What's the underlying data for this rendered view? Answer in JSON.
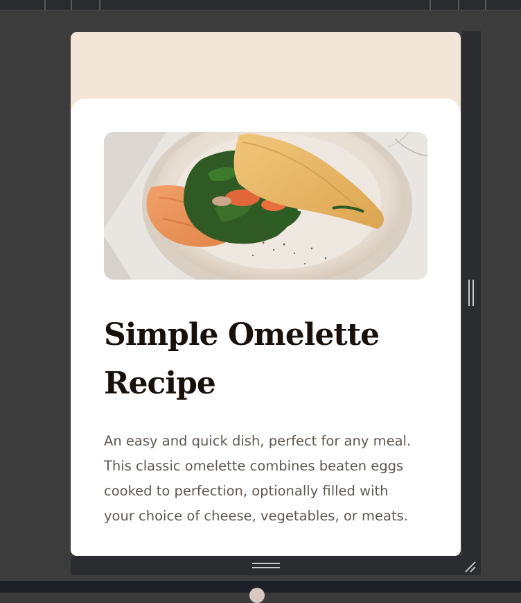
{
  "recipe": {
    "title": "Simple Omelette Recipe",
    "description": "An easy and quick dish, perfect for any meal. This classic omelette combines beaten eggs cooked to perfection, optionally filled with your choice of cheese, vegetables, or meats."
  },
  "colors": {
    "page_background": "#f3e5d8",
    "card": "#ffffff",
    "title": "#17100b",
    "body_text": "#5f5650",
    "frame": "#2b2c2f"
  },
  "icons": {
    "vertical_handle": "vertical-resize-grip-icon",
    "horizontal_handle": "horizontal-resize-grip-icon",
    "corner_handle": "corner-resize-icon"
  }
}
